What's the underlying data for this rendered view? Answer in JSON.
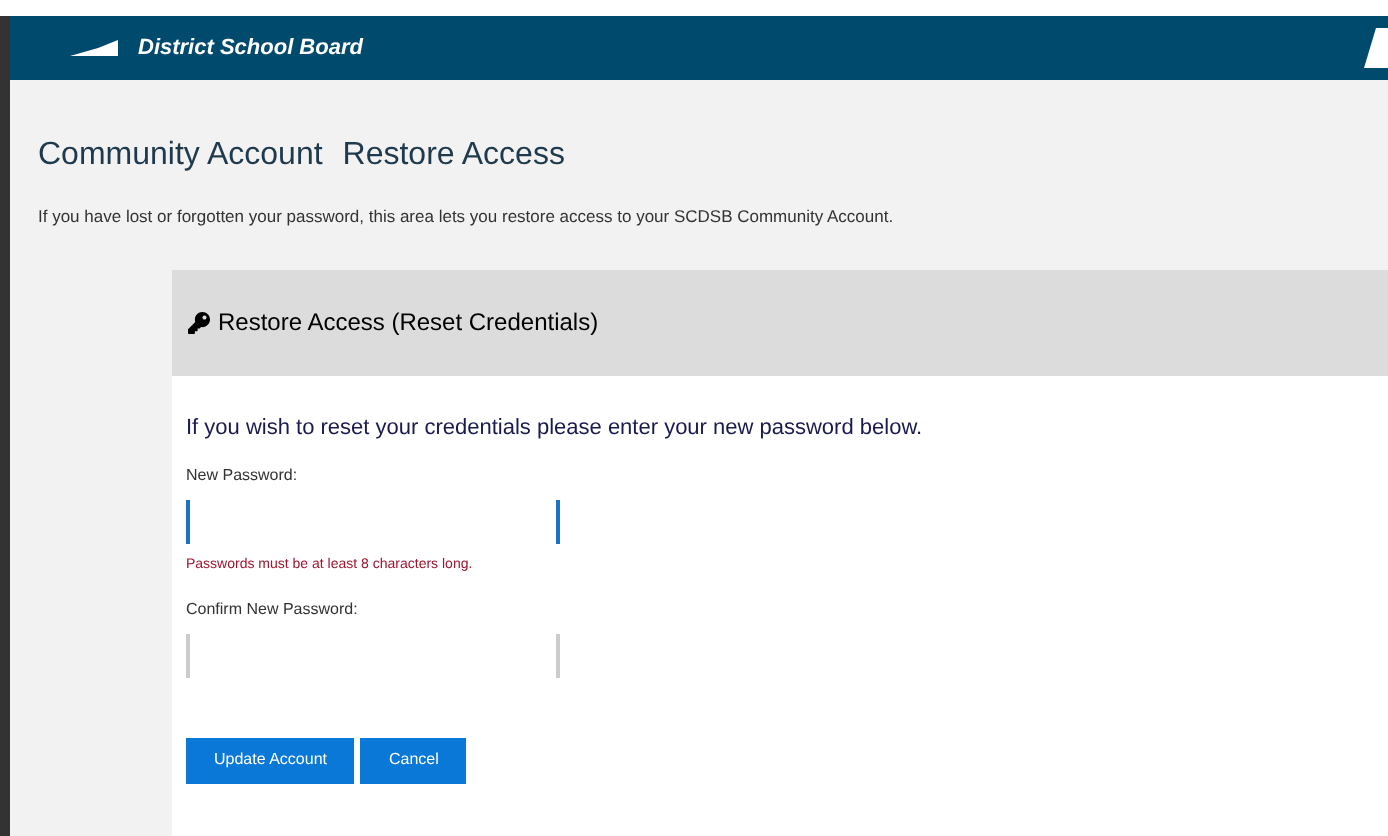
{
  "header": {
    "brand": "District School Board"
  },
  "page": {
    "title": "Community Account",
    "subtitle": "Restore Access",
    "intro": "If you have lost or forgotten your password, this area lets you restore access to your SCDSB Community Account."
  },
  "card": {
    "title": "Restore Access (Reset Credentials)",
    "instruction": "If you wish to reset your credentials please enter your new password below.",
    "fields": [
      {
        "label": "New Password:",
        "focused": true,
        "error": "Passwords must be at least 8 characters long."
      },
      {
        "label": "Confirm New Password:",
        "focused": false
      }
    ],
    "buttons": [
      "Update Account",
      "Cancel"
    ]
  }
}
